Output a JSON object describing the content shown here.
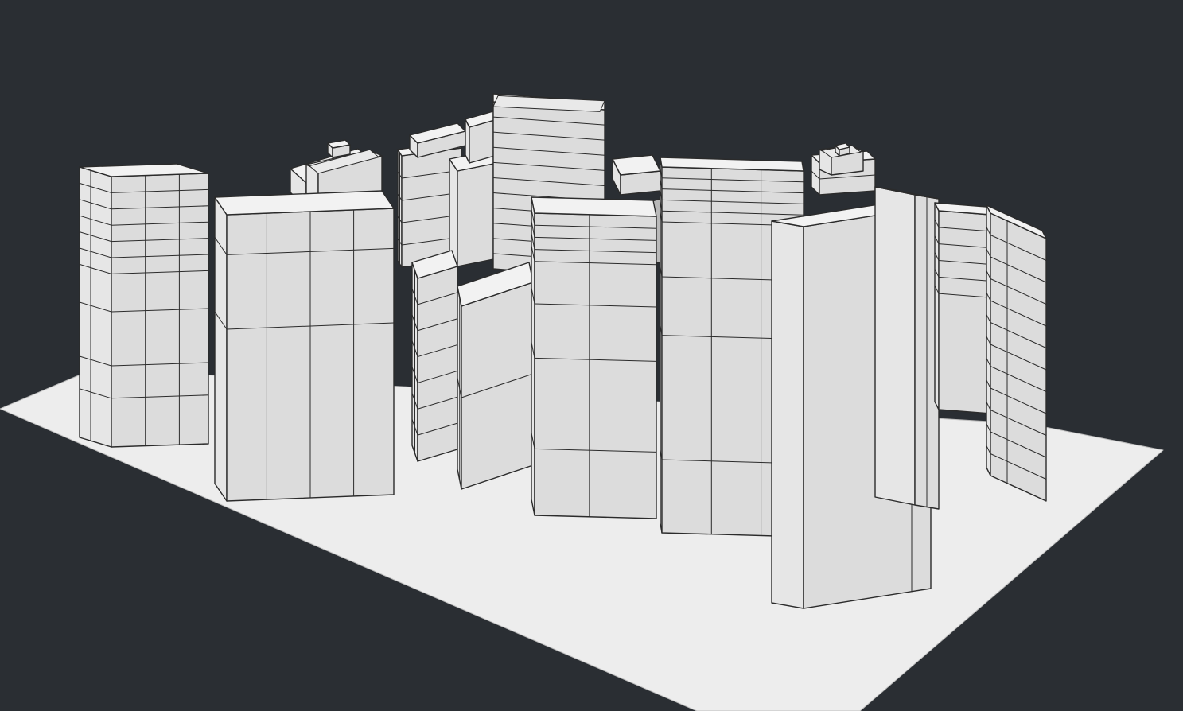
{
  "viewport": {
    "background_color": "#2a2e33",
    "ground_color": "#ededed",
    "face_left_color": "#e6e6e6",
    "face_right_color": "#dcdcdc",
    "face_top_color": "#f2f2f2",
    "edge_color": "#2b2b2b",
    "shadow_color": "#b9b9b9"
  }
}
